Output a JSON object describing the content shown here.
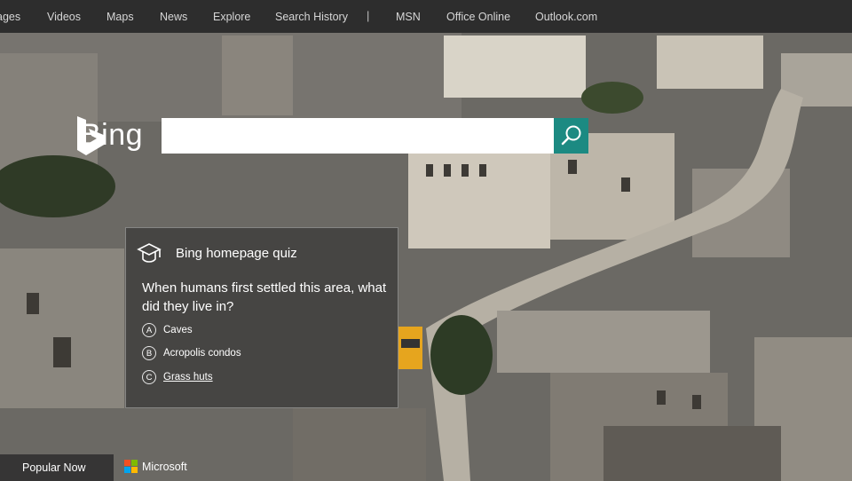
{
  "nav": {
    "items": [
      "ages",
      "Videos",
      "Maps",
      "News",
      "Explore",
      "Search History"
    ],
    "separator": "|",
    "links": [
      "MSN",
      "Office Online",
      "Outlook.com"
    ]
  },
  "logo": {
    "text": "Bing"
  },
  "search": {
    "placeholder": "",
    "value": ""
  },
  "quiz": {
    "title": "Bing homepage quiz",
    "question": "When humans first settled this area, what did they live in?",
    "options": [
      {
        "letter": "A",
        "label": "Caves"
      },
      {
        "letter": "B",
        "label": "Acropolis condos"
      },
      {
        "letter": "C",
        "label": "Grass huts"
      }
    ]
  },
  "footer": {
    "popular": "Popular Now",
    "brand": "Microsoft"
  },
  "colors": {
    "topbar": "#2d2d2d",
    "search_button": "#1c8a82",
    "ms_red": "#f25022",
    "ms_green": "#7fba00",
    "ms_blue": "#00a4ef",
    "ms_yellow": "#ffb900"
  }
}
